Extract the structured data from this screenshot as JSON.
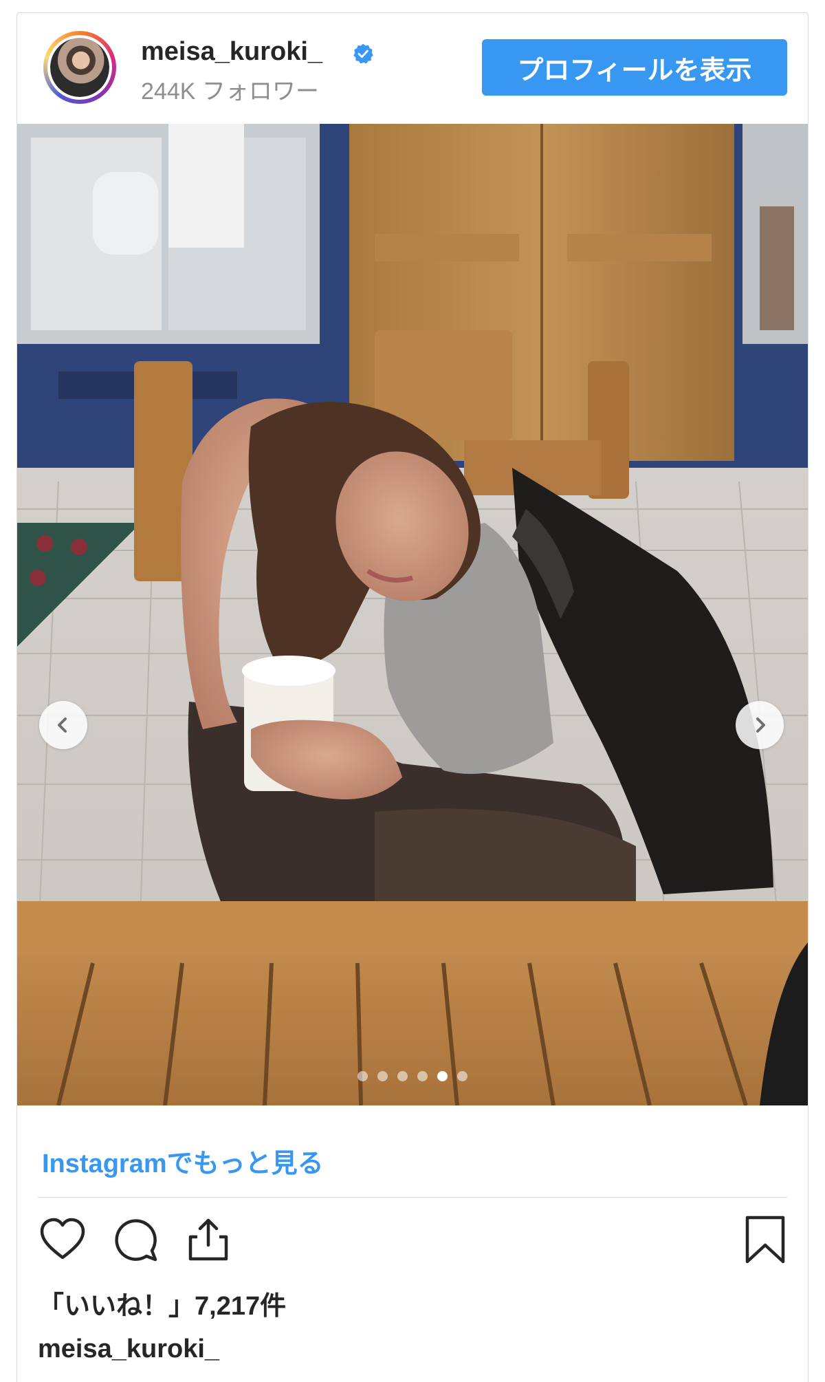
{
  "header": {
    "username": "meisa_kuroki_",
    "followers": "244K フォロワー",
    "profile_button": "プロフィールを表示"
  },
  "carousel": {
    "slide_count": 6,
    "active_index": 4
  },
  "more_link": "Instagramでもっと見る",
  "likes": "「いいね！」7,217件",
  "caption_username": "meisa_kuroki_",
  "colors": {
    "accent": "#3897f0",
    "text": "#262626",
    "muted": "#8e8e8e",
    "border": "#dbdbdb"
  },
  "icons": [
    "verified-badge-icon",
    "chevron-left-icon",
    "chevron-right-icon",
    "heart-icon",
    "comment-icon",
    "share-icon",
    "bookmark-icon"
  ]
}
